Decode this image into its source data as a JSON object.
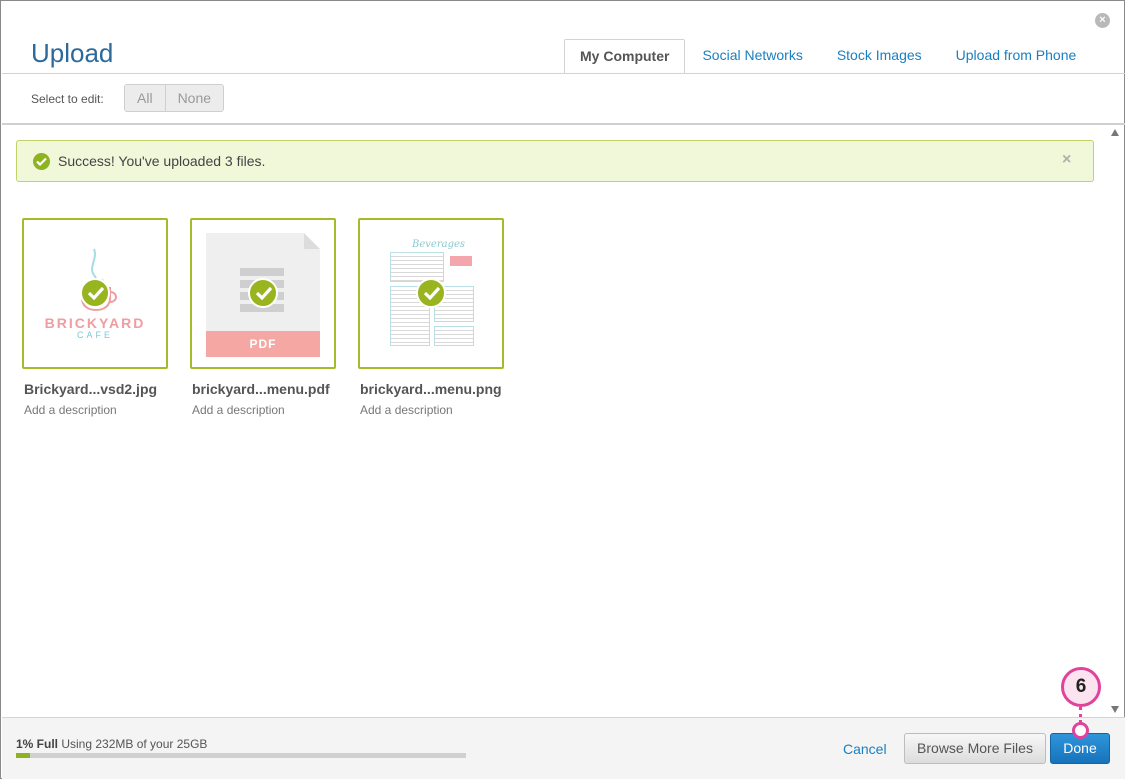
{
  "dialog": {
    "title": "Upload",
    "close_icon": "close-circle-icon"
  },
  "tabs": [
    {
      "label": "My Computer",
      "active": true
    },
    {
      "label": "Social Networks",
      "active": false
    },
    {
      "label": "Stock Images",
      "active": false
    },
    {
      "label": "Upload from Phone",
      "active": false
    }
  ],
  "toolbar": {
    "select_label": "Select to edit:",
    "all_label": "All",
    "none_label": "None"
  },
  "alert": {
    "message": "Success! You've uploaded 3 files.",
    "icon": "check-circle-icon",
    "close_glyph": "×"
  },
  "files": [
    {
      "name": "Brickyard...vsd2.jpg",
      "description": "Add a description",
      "thumbnail": "logo",
      "logo_text": "BRICKYARD",
      "logo_sub": "CAFE"
    },
    {
      "name": "brickyard...menu.pdf",
      "description": "Add a description",
      "thumbnail": "pdf",
      "badge": "PDF"
    },
    {
      "name": "brickyard...menu.png",
      "description": "Add a description",
      "thumbnail": "menu",
      "sheet_title": "Beverages"
    }
  ],
  "footer": {
    "storage_percent_label": "1% Full",
    "storage_detail": " Using 232MB of your 25GB",
    "storage_fraction": 0.03,
    "cancel_label": "Cancel",
    "browse_label": "Browse More Files",
    "done_label": "Done"
  },
  "callout": {
    "number": "6"
  },
  "colors": {
    "accent_blue": "#1a7fc1",
    "title_blue": "#2c6a9c",
    "success_green": "#98b41f",
    "callout_pink": "#e0439b"
  }
}
